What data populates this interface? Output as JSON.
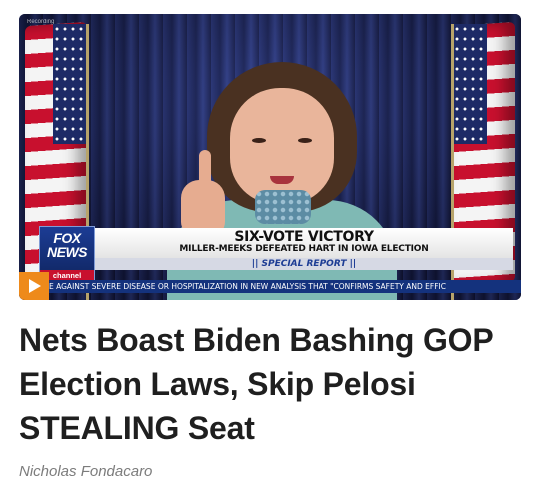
{
  "video": {
    "source_tag": "Recording",
    "logo": {
      "top": "FOX NEWS",
      "bottom": "channel"
    },
    "headline": "SIX-VOTE VICTORY",
    "subheadline": "MILLER-MEEKS DEFEATED HART IN IOWA ELECTION",
    "banner": "|| SPECIAL REPORT ||",
    "ticker": "E AGAINST SEVERE DISEASE OR HOSPITALIZATION IN NEW ANALYSIS THAT \"CONFIRMS SAFETY AND EFFIC",
    "play_icon": "play-icon",
    "colors": {
      "play_button": "#ee8a1b",
      "ticker_bg": "#14327d"
    }
  },
  "article": {
    "title": "Nets Boast Biden Bashing GOP Election Laws, Skip Pelosi STEALING Seat",
    "author": "Nicholas Fondacaro"
  }
}
